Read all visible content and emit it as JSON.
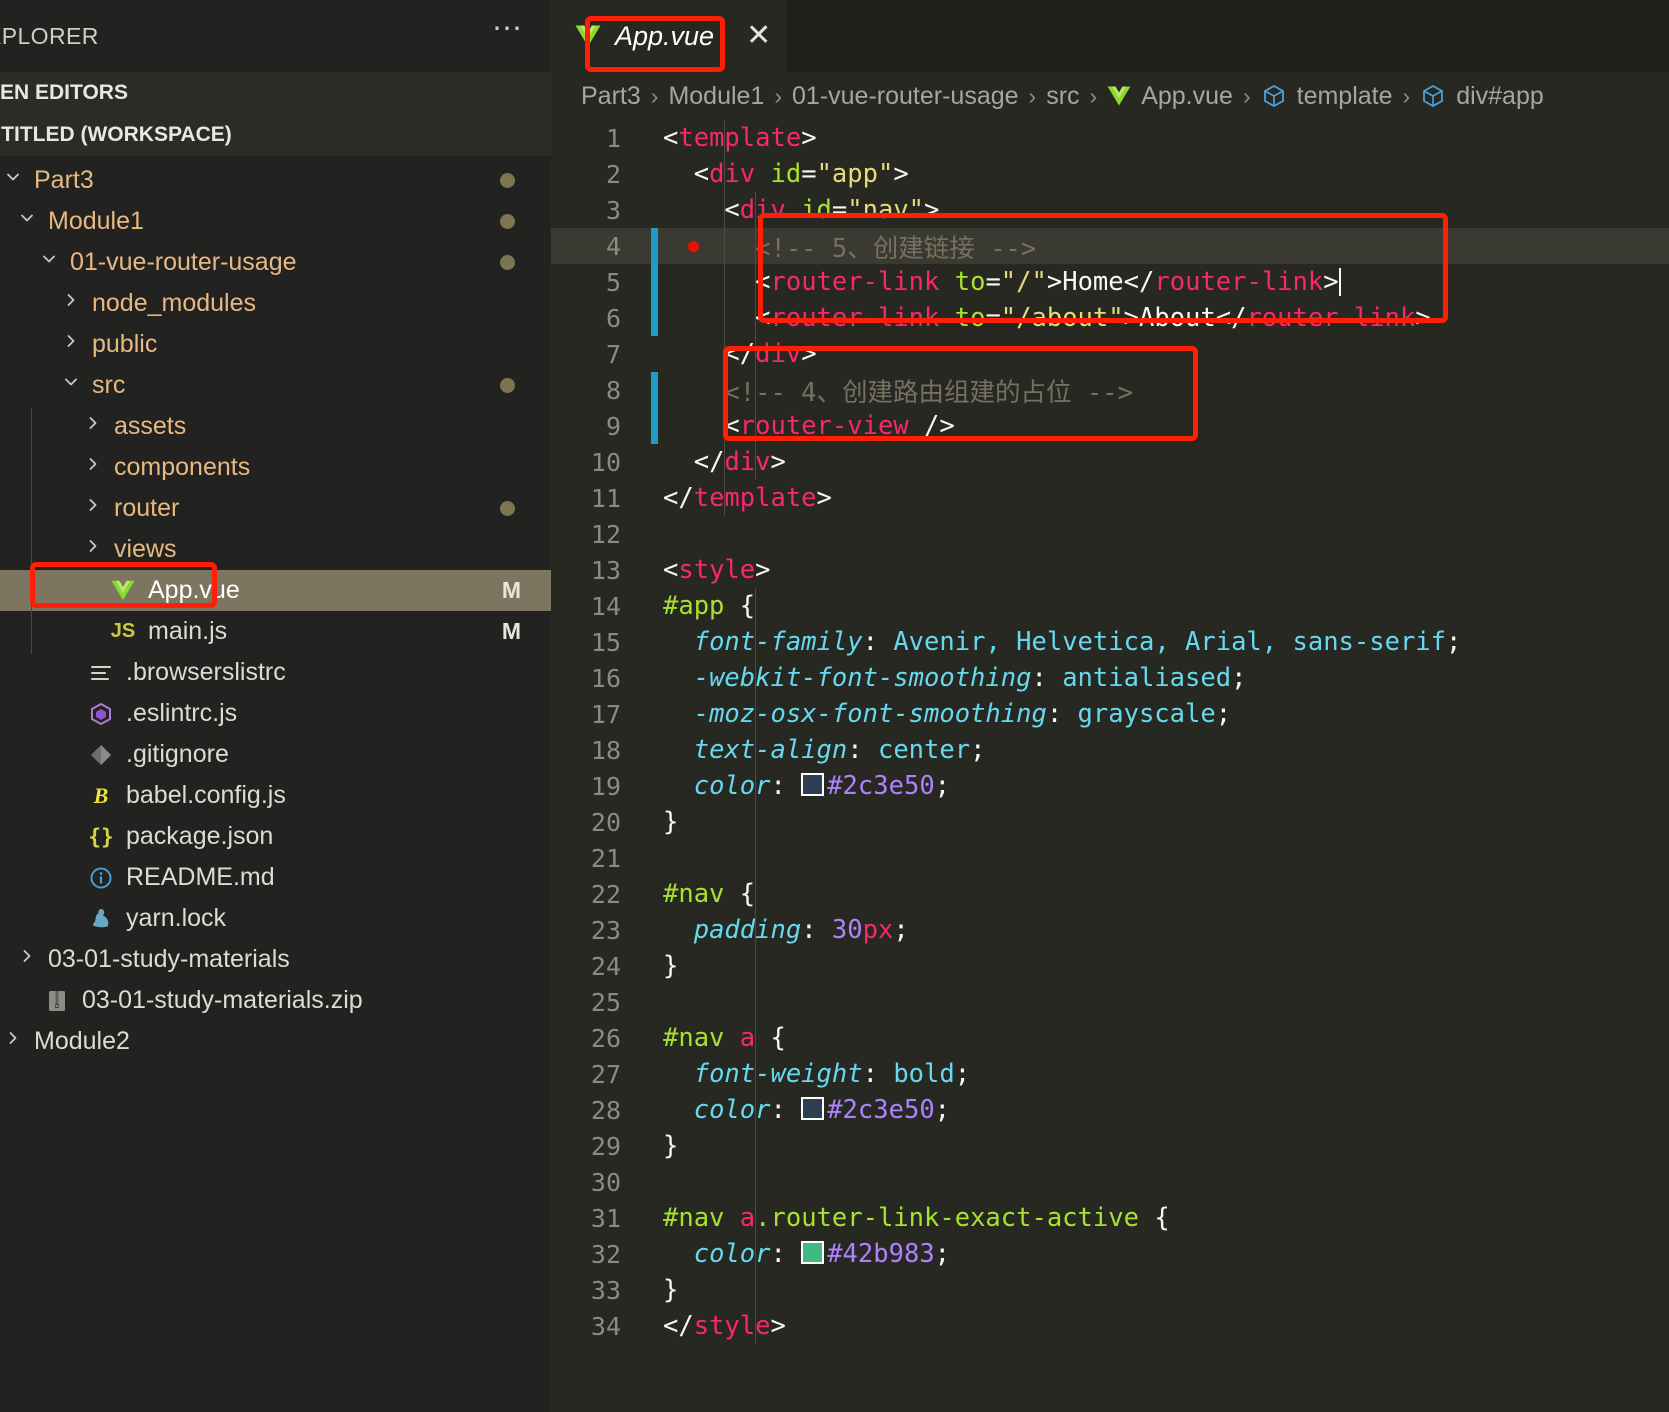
{
  "sidebar": {
    "title": "XPLORER",
    "more_icon": "ellipsis-icon",
    "sections": [
      {
        "label": "PEN EDITORS"
      },
      {
        "label": "NTITLED (WORKSPACE)"
      }
    ],
    "tree": [
      {
        "label": "Part3",
        "chevron": "chevron-down-icon",
        "kind": "folder",
        "indent": 0,
        "dot": true,
        "badge": ""
      },
      {
        "label": "Module1",
        "chevron": "chevron-down-icon",
        "kind": "folder",
        "indent": 1,
        "dot": true,
        "badge": ""
      },
      {
        "label": "01-vue-router-usage",
        "chevron": "chevron-down-icon",
        "kind": "folder",
        "indent": 2,
        "dot": true,
        "badge": ""
      },
      {
        "label": "node_modules",
        "chevron": "chevron-right-icon",
        "kind": "folder",
        "indent": 3,
        "dot": false,
        "badge": ""
      },
      {
        "label": "public",
        "chevron": "chevron-right-icon",
        "kind": "folder",
        "indent": 3,
        "dot": false,
        "badge": ""
      },
      {
        "label": "src",
        "chevron": "chevron-down-icon",
        "kind": "folder",
        "indent": 3,
        "dot": true,
        "badge": ""
      },
      {
        "label": "assets",
        "chevron": "chevron-right-icon",
        "kind": "folder",
        "indent": 4,
        "dot": false,
        "badge": ""
      },
      {
        "label": "components",
        "chevron": "chevron-right-icon",
        "kind": "folder",
        "indent": 4,
        "dot": false,
        "badge": ""
      },
      {
        "label": "router",
        "chevron": "chevron-right-icon",
        "kind": "folder",
        "indent": 4,
        "dot": true,
        "badge": ""
      },
      {
        "label": "views",
        "chevron": "chevron-right-icon",
        "kind": "folder",
        "indent": 4,
        "dot": false,
        "badge": ""
      },
      {
        "label": "App.vue",
        "chevron": "",
        "kind": "vue",
        "indent": 4,
        "dot": false,
        "badge": "M",
        "selected": true
      },
      {
        "label": "main.js",
        "chevron": "",
        "kind": "js",
        "indent": 4,
        "dot": false,
        "badge": "M"
      },
      {
        "label": ".browserslistrc",
        "chevron": "",
        "kind": "config",
        "indent": 3,
        "dot": false,
        "badge": ""
      },
      {
        "label": ".eslintrc.js",
        "chevron": "",
        "kind": "eslint",
        "indent": 3,
        "dot": false,
        "badge": ""
      },
      {
        "label": ".gitignore",
        "chevron": "",
        "kind": "git",
        "indent": 3,
        "dot": false,
        "badge": ""
      },
      {
        "label": "babel.config.js",
        "chevron": "",
        "kind": "babel",
        "indent": 3,
        "dot": false,
        "badge": ""
      },
      {
        "label": "package.json",
        "chevron": "",
        "kind": "json",
        "indent": 3,
        "dot": false,
        "badge": ""
      },
      {
        "label": "README.md",
        "chevron": "",
        "kind": "readme",
        "indent": 3,
        "dot": false,
        "badge": ""
      },
      {
        "label": "yarn.lock",
        "chevron": "",
        "kind": "yarn",
        "indent": 3,
        "dot": false,
        "badge": ""
      },
      {
        "label": "03-01-study-materials",
        "chevron": "chevron-right-icon",
        "kind": "plainfolder",
        "indent": 1,
        "dot": false,
        "badge": ""
      },
      {
        "label": "03-01-study-materials.zip",
        "chevron": "",
        "kind": "zip",
        "indent": 1,
        "dot": false,
        "badge": ""
      },
      {
        "label": "Module2",
        "chevron": "chevron-right-icon",
        "kind": "plainfolder",
        "indent": 0,
        "dot": false,
        "badge": ""
      }
    ]
  },
  "tab": {
    "label": "App.vue",
    "icon": "vue-icon",
    "close_icon": "close-icon",
    "italic": true
  },
  "breadcrumb": {
    "items": [
      {
        "label": "Part3",
        "icon": ""
      },
      {
        "label": "Module1",
        "icon": ""
      },
      {
        "label": "01-vue-router-usage",
        "icon": ""
      },
      {
        "label": "src",
        "icon": ""
      },
      {
        "label": "App.vue",
        "icon": "vue-icon"
      },
      {
        "label": "template",
        "icon": "symbol-field-icon"
      },
      {
        "label": "div#app",
        "icon": "symbol-field-icon"
      }
    ],
    "separator": "›"
  },
  "editor": {
    "colors": {
      "background": "#272822",
      "tag": "#f92672",
      "attribute": "#a6e22e",
      "string": "#e6db74",
      "comment": "#75715e",
      "property": "#66d9ef",
      "number": "#ae81ff",
      "text": "#f8f8f2",
      "line_highlight": "#3b3a32",
      "change_bar": "#1b9ec6",
      "breakpoint": "#e51400"
    },
    "swatch_colors": {
      "dark_navy": "#2c3e50",
      "vue_green": "#42b983"
    },
    "lines": [
      {
        "n": 1,
        "text": "<template>"
      },
      {
        "n": 2,
        "text": "  <div id=\"app\">"
      },
      {
        "n": 3,
        "text": "    <div id=\"nav\">"
      },
      {
        "n": 4,
        "text": "      <!-- 5、创建链接 -->"
      },
      {
        "n": 5,
        "text": "      <router-link to=\"/\">Home</router-link>"
      },
      {
        "n": 6,
        "text": "      <router-link to=\"/about\">About</router-link>"
      },
      {
        "n": 7,
        "text": "    </div>"
      },
      {
        "n": 8,
        "text": "    <!-- 4、创建路由组建的占位 -->"
      },
      {
        "n": 9,
        "text": "    <router-view />"
      },
      {
        "n": 10,
        "text": "  </div>"
      },
      {
        "n": 11,
        "text": "</template>"
      },
      {
        "n": 12,
        "text": ""
      },
      {
        "n": 13,
        "text": "<style>"
      },
      {
        "n": 14,
        "text": "#app {"
      },
      {
        "n": 15,
        "text": "  font-family: Avenir, Helvetica, Arial, sans-serif;"
      },
      {
        "n": 16,
        "text": "  -webkit-font-smoothing: antialiased;"
      },
      {
        "n": 17,
        "text": "  -moz-osx-font-smoothing: grayscale;"
      },
      {
        "n": 18,
        "text": "  text-align: center;"
      },
      {
        "n": 19,
        "text": "  color: #2c3e50;"
      },
      {
        "n": 20,
        "text": "}"
      },
      {
        "n": 21,
        "text": ""
      },
      {
        "n": 22,
        "text": "#nav {"
      },
      {
        "n": 23,
        "text": "  padding: 30px;"
      },
      {
        "n": 24,
        "text": "}"
      },
      {
        "n": 25,
        "text": ""
      },
      {
        "n": 26,
        "text": "#nav a {"
      },
      {
        "n": 27,
        "text": "  font-weight: bold;"
      },
      {
        "n": 28,
        "text": "  color: #2c3e50;"
      },
      {
        "n": 29,
        "text": "}"
      },
      {
        "n": 30,
        "text": ""
      },
      {
        "n": 31,
        "text": "#nav a.router-link-exact-active {"
      },
      {
        "n": 32,
        "text": "  color: #42b983;"
      },
      {
        "n": 33,
        "text": "}"
      },
      {
        "n": 34,
        "text": "</style>"
      }
    ],
    "cursor_line": 5,
    "highlight_line": 4,
    "breakpoint_line": 4,
    "change_bar_lines": [
      4,
      5,
      6,
      8,
      9
    ]
  },
  "annotations": {
    "color": "#fe1f06",
    "boxes": [
      {
        "name": "tab-highlight-box"
      },
      {
        "name": "code-links-box"
      },
      {
        "name": "router-view-box"
      },
      {
        "name": "sidebar-appvue-box"
      }
    ]
  }
}
